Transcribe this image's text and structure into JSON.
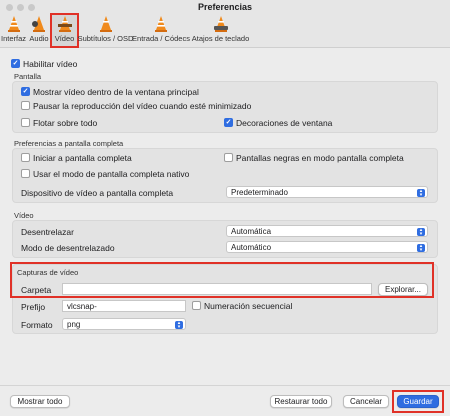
{
  "window": {
    "title": "Preferencias"
  },
  "toolbar": {
    "items": [
      {
        "label": "Interfaz",
        "icon": "cone-icon"
      },
      {
        "label": "Audio",
        "icon": "speaker-icon"
      },
      {
        "label": "Vídeo",
        "icon": "video-cone-icon"
      },
      {
        "label": "Subtítulos / OSD",
        "icon": "subtitles-icon"
      },
      {
        "label": "Entrada / Códecs",
        "icon": "input-cone-icon"
      },
      {
        "label": "Atajos de teclado",
        "icon": "keyboard-cone-icon"
      }
    ],
    "selected": "Vídeo"
  },
  "video": {
    "enable_label": "Habilitar vídeo",
    "display": {
      "title": "Pantalla",
      "embedded_label": "Mostrar vídeo dentro de la ventana principal",
      "pause_minimized_label": "Pausar la reproducción del vídeo cuando esté minimizado",
      "on_top_label": "Flotar sobre todo",
      "decorations_label": "Decoraciones de ventana"
    },
    "fullscreen": {
      "title": "Preferencias a pantalla completa",
      "start_fullscreen_label": "Iniciar a pantalla completa",
      "black_screens_label": "Pantallas negras en modo pantalla completa",
      "native_label": "Usar el modo de pantalla completa nativo",
      "device_label": "Dispositivo de vídeo a pantalla completa",
      "device_value": "Predeterminado"
    },
    "video_section": {
      "title": "Vídeo",
      "deinterlace_label": "Desentrelazar",
      "deinterlace_value": "Automática",
      "deinterlace_mode_label": "Modo de desentrelazado",
      "deinterlace_mode_value": "Automático"
    },
    "snapshots": {
      "title": "Capturas de vídeo",
      "folder_label": "Carpeta",
      "folder_value": "",
      "browse_label": "Explorar...",
      "prefix_label": "Prefijo",
      "prefix_value": "vlcsnap-",
      "sequential_label": "Numeración secuencial",
      "format_label": "Formato",
      "format_value": "png"
    }
  },
  "footer": {
    "show_all_label": "Mostrar todo",
    "reset_label": "Restaurar todo",
    "cancel_label": "Cancelar",
    "save_label": "Guardar"
  },
  "colors": {
    "accent": "#2f6de1",
    "highlight_box": "#e03127"
  }
}
